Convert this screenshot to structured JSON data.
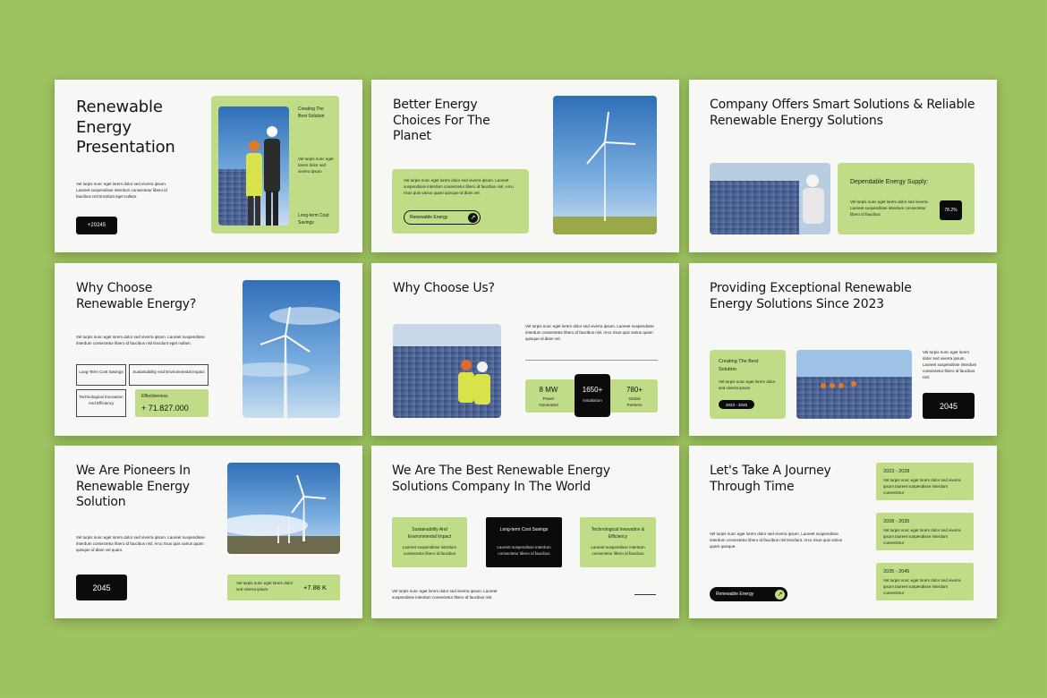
{
  "colors": {
    "background": "#9cc15f",
    "accent": "#c1dc86",
    "dark": "#0b0b0b",
    "slide": "#f7f7f5"
  },
  "s1": {
    "title": "Renewable Energy Presentation",
    "body": "Vel turpis nunc eget lorem dolor sed viverra ipsum. Laoreet suspendisse interdum consectetur libero id faucibus nisl tincidunt eget nullam.",
    "button": "+20245",
    "card_heading": "Creating The Best Solution",
    "card_body": "Vel turpis nunc eget lorem dolor sed viverra ipsum",
    "card_footer": "Long-term Cost Savings"
  },
  "s2": {
    "title": "Better Energy Choices For The Planet",
    "body": "Vel turpis nunc eget lorem dolor sed viverra ipsum. Laoreet suspendisse interdum consectetur libero id faucibus nisl. Arcu risus quis varius quam quisque id diam vel.",
    "pill": "Renewable Energy"
  },
  "s3": {
    "title": "Company Offers Smart Solutions & Reliable Renewable Energy Solutions",
    "card_heading": "Dependable Energy Supply:",
    "card_body": "Vel turpis nunc eget lorem dolor sed viverra. Laoreet suspendisse interdum consectetur libero id faucibus.",
    "badge": "78.2%"
  },
  "s4": {
    "title": "Why Choose Renewable Energy?",
    "body": "Vel turpis nunc eget lorem dolor sed viverra ipsum. Laoreet suspendisse interdum consectetur libero id faucibus nisl tincidunt eget nullam.",
    "box1": "Long-Term Cost Savings",
    "box2": "Sustainability And Environmental Impact",
    "box3": "Technological Innovation And Efficiency",
    "eff_label": "Effectiveness",
    "eff_value": "+ 71.827.000"
  },
  "s5": {
    "title": "Why Choose Us?",
    "body": "Vel turpis nunc eget lorem dolor sed viverra ipsum. Laoreet suspendisse interdum consectetur libero id faucibus nisl. Arcu risus quis varius quam quisque id diam vel.",
    "stat1_value": "8 MW",
    "stat1_label": "Power Generated",
    "stat2_value": "1650+",
    "stat2_label": "Installation",
    "stat3_value": "780+",
    "stat3_label": "Global Partners"
  },
  "s6": {
    "title": "Providing Exceptional Renewable Energy Solutions Since 2023",
    "card_heading": "Creating The Best Solution",
    "card_body": "Vel turpis nunc eget lorem dolor sed viverra ipsum",
    "card_pill": "2023 - 2045",
    "body": "Vel turpis nunc eget lorem dolor sed viverra ipsum. Laoreet suspendisse interdum consectetur libero id faucibus nisl.",
    "badge": "2045"
  },
  "s7": {
    "title": "We Are Pioneers In Renewable Energy Solution",
    "body": "Vel turpis nunc eget lorem dolor sed viverra ipsum. Laoreet suspendisse interdum consectetur libero id faucibus nisl. Arcu risus quis varius quam quisque id diam vel quam.",
    "badge": "2045",
    "card_body": "Vel turpis nunc eget lorem dolor sed viverra ipsum.",
    "card_value": "+7.88 K"
  },
  "s8": {
    "title": "We Are The Best Renewable Energy Solutions Company In The World",
    "card1_heading": "Sustainability And Environmental Impact",
    "card1_body": "Laoreet suspendisse interdum consectetur libero id faucibus",
    "card2_heading": "Long-term Cost Savings",
    "card2_body": "Laoreet suspendisse interdum consectetur libero id faucibus",
    "card3_heading": "Technological Innovation & Efficiency",
    "card3_body": "Laoreet suspendisse interdum consectetur libero id faucibus",
    "body": "Vel turpis nunc eget lorem dolor sed viverra ipsum. Laoreet suspendisse interdum consectetur libero id faucibus nisl."
  },
  "s9": {
    "title": "Let's Take A Journey Through Time",
    "body": "Vel turpis nunc eget lorem dolor sed viverra ipsum. Laoreet suspendisse interdum consectetur libero id faucibus nisl tincidunt. Arcu risus quis varius quam quisque.",
    "pill": "Renewable Energy",
    "t1_title": "2023 - 2028",
    "t1_body": "Vel turpis nunc eget lorem dolor sed viverra ipsum laoreet suspendisse interdum consectetur",
    "t2_title": "2028 - 2035",
    "t2_body": "Vel turpis nunc eget lorem dolor sed viverra ipsum laoreet suspendisse interdum consectetur",
    "t3_title": "2035 - 2045",
    "t3_body": "Vel turpis nunc eget lorem dolor sed viverra ipsum laoreet suspendisse interdum consectetur"
  }
}
